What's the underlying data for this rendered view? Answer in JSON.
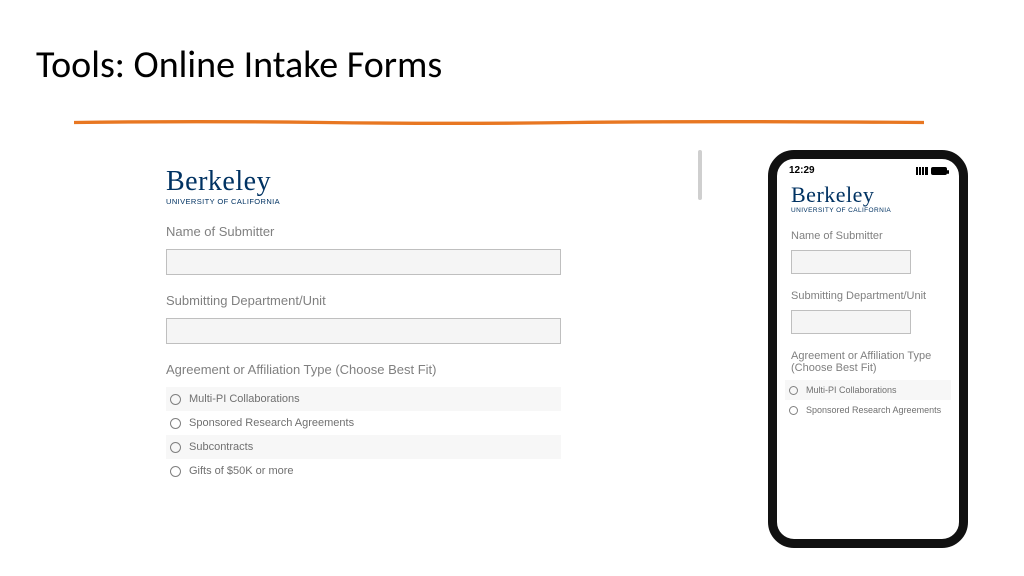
{
  "title": "Tools: Online Intake Forms",
  "logo": {
    "name": "Berkeley",
    "sub": "UNIVERSITY OF CALIFORNIA"
  },
  "form": {
    "field1_label": "Name of Submitter",
    "field2_label": "Submitting Department/Unit",
    "field3_label": "Agreement or Affiliation Type (Choose Best Fit)",
    "options": [
      "Multi-PI Collaborations",
      "Sponsored Research Agreements",
      "Subcontracts",
      "Gifts of $50K or more"
    ]
  },
  "phone": {
    "time": "12:29",
    "field3_label": "Agreement or Affiliation Type\n (Choose Best Fit)",
    "options": [
      "Multi-PI Collaborations",
      "Sponsored Research Agreements"
    ]
  }
}
